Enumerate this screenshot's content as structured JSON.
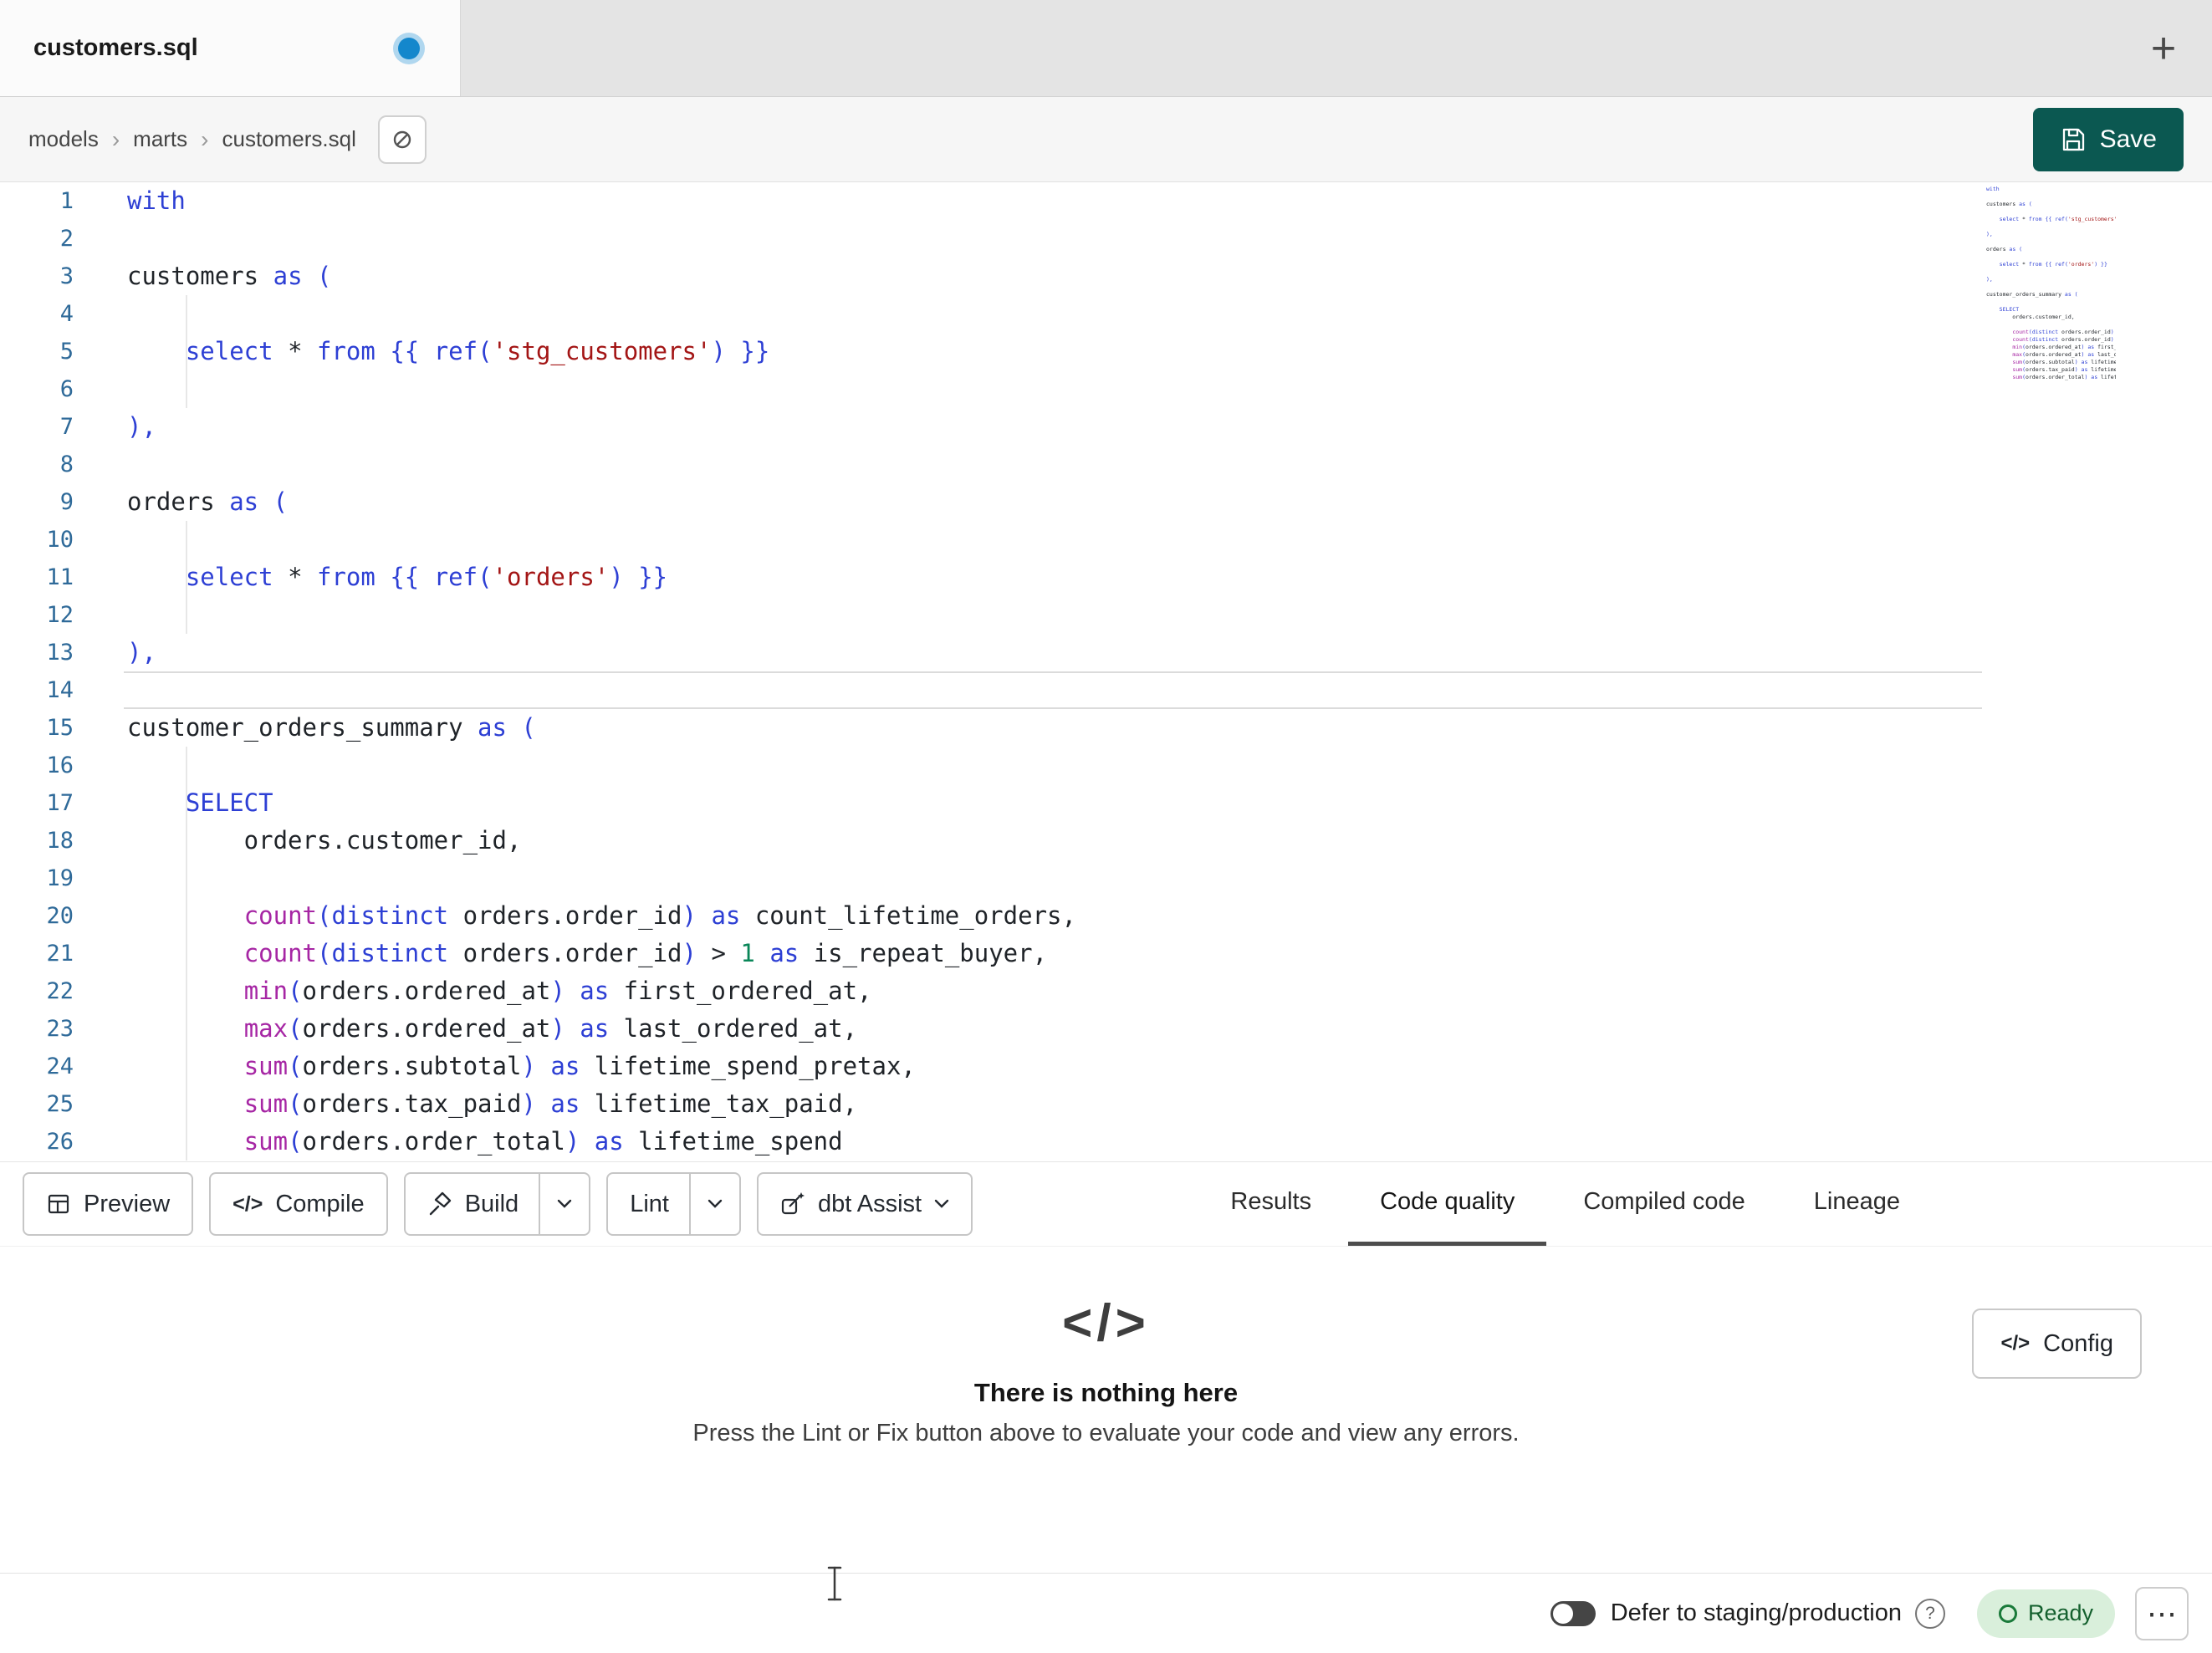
{
  "tab_bar": {
    "active_tab": "customers.sql",
    "new_tab": "+"
  },
  "breadcrumb": {
    "items": [
      "models",
      "marts",
      "customers.sql"
    ],
    "separator": "›"
  },
  "save": {
    "label": "Save"
  },
  "editor": {
    "lines": [
      {
        "n": 1,
        "t": [
          [
            "kw",
            "with"
          ]
        ]
      },
      {
        "n": 2,
        "t": []
      },
      {
        "n": 3,
        "t": [
          [
            "id",
            "customers "
          ],
          [
            "kw",
            "as"
          ],
          [
            "id",
            " "
          ],
          [
            "pn",
            "("
          ]
        ]
      },
      {
        "n": 4,
        "t": []
      },
      {
        "n": 5,
        "t": [
          [
            "id",
            "    "
          ],
          [
            "kw",
            "select"
          ],
          [
            "id",
            " * "
          ],
          [
            "kw",
            "from"
          ],
          [
            "id",
            " "
          ],
          [
            "pn",
            "{{"
          ],
          [
            "id",
            " "
          ],
          [
            "kw",
            "ref"
          ],
          [
            "pn",
            "("
          ],
          [
            "str",
            "'stg_customers'"
          ],
          [
            "pn",
            ")"
          ],
          [
            "id",
            " "
          ],
          [
            "pn",
            "}}"
          ]
        ]
      },
      {
        "n": 6,
        "t": []
      },
      {
        "n": 7,
        "t": [
          [
            "pn",
            "),"
          ]
        ]
      },
      {
        "n": 8,
        "t": []
      },
      {
        "n": 9,
        "t": [
          [
            "id",
            "orders "
          ],
          [
            "kw",
            "as"
          ],
          [
            "id",
            " "
          ],
          [
            "pn",
            "("
          ]
        ]
      },
      {
        "n": 10,
        "t": []
      },
      {
        "n": 11,
        "t": [
          [
            "id",
            "    "
          ],
          [
            "kw",
            "select"
          ],
          [
            "id",
            " * "
          ],
          [
            "kw",
            "from"
          ],
          [
            "id",
            " "
          ],
          [
            "pn",
            "{{"
          ],
          [
            "id",
            " "
          ],
          [
            "kw",
            "ref"
          ],
          [
            "pn",
            "("
          ],
          [
            "str",
            "'orders'"
          ],
          [
            "pn",
            ")"
          ],
          [
            "id",
            " "
          ],
          [
            "pn",
            "}}"
          ]
        ]
      },
      {
        "n": 12,
        "t": []
      },
      {
        "n": 13,
        "t": [
          [
            "pn",
            "),"
          ]
        ]
      },
      {
        "n": 14,
        "t": [],
        "current": true
      },
      {
        "n": 15,
        "t": [
          [
            "id",
            "customer_orders_summary "
          ],
          [
            "kw",
            "as"
          ],
          [
            "id",
            " "
          ],
          [
            "pn",
            "("
          ]
        ]
      },
      {
        "n": 16,
        "t": []
      },
      {
        "n": 17,
        "t": [
          [
            "id",
            "    "
          ],
          [
            "kw",
            "SELECT"
          ]
        ]
      },
      {
        "n": 18,
        "t": [
          [
            "id",
            "        orders.customer_id,"
          ]
        ]
      },
      {
        "n": 19,
        "t": []
      },
      {
        "n": 20,
        "t": [
          [
            "id",
            "        "
          ],
          [
            "fn",
            "count"
          ],
          [
            "pn",
            "("
          ],
          [
            "kw",
            "distinct"
          ],
          [
            "id",
            " orders.order_id"
          ],
          [
            "pn",
            ")"
          ],
          [
            "id",
            " "
          ],
          [
            "kw",
            "as"
          ],
          [
            "id",
            " count_lifetime_orders,"
          ]
        ]
      },
      {
        "n": 21,
        "t": [
          [
            "id",
            "        "
          ],
          [
            "fn",
            "count"
          ],
          [
            "pn",
            "("
          ],
          [
            "kw",
            "distinct"
          ],
          [
            "id",
            " orders.order_id"
          ],
          [
            "pn",
            ")"
          ],
          [
            "id",
            " > "
          ],
          [
            "num",
            "1"
          ],
          [
            "id",
            " "
          ],
          [
            "kw",
            "as"
          ],
          [
            "id",
            " is_repeat_buyer,"
          ]
        ]
      },
      {
        "n": 22,
        "t": [
          [
            "id",
            "        "
          ],
          [
            "fn",
            "min"
          ],
          [
            "pn",
            "("
          ],
          [
            "id",
            "orders.ordered_at"
          ],
          [
            "pn",
            ")"
          ],
          [
            "id",
            " "
          ],
          [
            "kw",
            "as"
          ],
          [
            "id",
            " first_ordered_at,"
          ]
        ]
      },
      {
        "n": 23,
        "t": [
          [
            "id",
            "        "
          ],
          [
            "fn",
            "max"
          ],
          [
            "pn",
            "("
          ],
          [
            "id",
            "orders.ordered_at"
          ],
          [
            "pn",
            ")"
          ],
          [
            "id",
            " "
          ],
          [
            "kw",
            "as"
          ],
          [
            "id",
            " last_ordered_at,"
          ]
        ]
      },
      {
        "n": 24,
        "t": [
          [
            "id",
            "        "
          ],
          [
            "fn",
            "sum"
          ],
          [
            "pn",
            "("
          ],
          [
            "id",
            "orders.subtotal"
          ],
          [
            "pn",
            ")"
          ],
          [
            "id",
            " "
          ],
          [
            "kw",
            "as"
          ],
          [
            "id",
            " lifetime_spend_pretax,"
          ]
        ]
      },
      {
        "n": 25,
        "t": [
          [
            "id",
            "        "
          ],
          [
            "fn",
            "sum"
          ],
          [
            "pn",
            "("
          ],
          [
            "id",
            "orders.tax_paid"
          ],
          [
            "pn",
            ")"
          ],
          [
            "id",
            " "
          ],
          [
            "kw",
            "as"
          ],
          [
            "id",
            " lifetime_tax_paid,"
          ]
        ]
      },
      {
        "n": 26,
        "t": [
          [
            "id",
            "        "
          ],
          [
            "fn",
            "sum"
          ],
          [
            "pn",
            "("
          ],
          [
            "id",
            "orders.order_total"
          ],
          [
            "pn",
            ")"
          ],
          [
            "id",
            " "
          ],
          [
            "kw",
            "as"
          ],
          [
            "id",
            " lifetime_spend"
          ]
        ]
      }
    ]
  },
  "toolbar": {
    "preview": "Preview",
    "compile": "Compile",
    "compile_icon": "</>",
    "build": "Build",
    "lint": "Lint",
    "assist": "dbt Assist"
  },
  "panel_tabs": {
    "items": [
      {
        "label": "Results",
        "active": false
      },
      {
        "label": "Code quality",
        "active": true
      },
      {
        "label": "Compiled code",
        "active": false
      },
      {
        "label": "Lineage",
        "active": false
      }
    ]
  },
  "results_panel": {
    "icon": "</>",
    "title": "There is nothing here",
    "subtitle": "Press the Lint or Fix button above to evaluate your code and view any errors.",
    "config_icon": "</>",
    "config_label": "Config"
  },
  "status_bar": {
    "defer_label": "Defer to staging/production",
    "help": "?",
    "ready": "Ready",
    "more": "⋯"
  },
  "colors": {
    "keyword": "#2d3fd4",
    "function": "#a626a4",
    "string": "#a31515",
    "number": "#098658",
    "identifier": "#1f2328",
    "punct": "#2d3fd4",
    "lineno": "#2f6a99",
    "save_button": "#0b5851",
    "ready_bg": "#d9efdb",
    "ready_text": "#14602e",
    "ready_ring": "#1a7a3a",
    "unsaved_dot": "#1487cc",
    "active_underline": "#4d4d4d"
  }
}
